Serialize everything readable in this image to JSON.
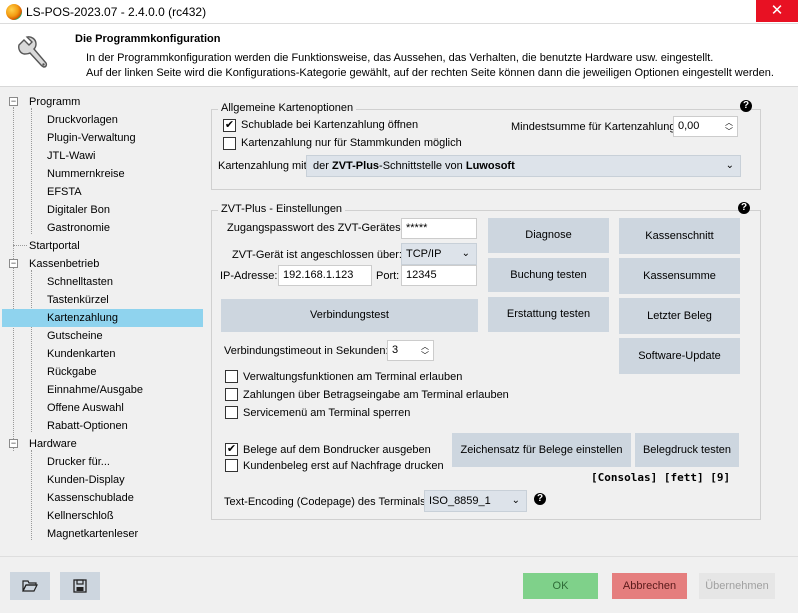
{
  "window": {
    "title": "LS-POS-2023.07 - 2.4.0.0 (rc432)",
    "close_symbol": "✕"
  },
  "header": {
    "title": "Die Programmkonfiguration",
    "desc_line1": "In der Programmkonfiguration werden die Funktionsweise, das Aussehen, das Verhalten, die benutzte Hardware usw. eingestellt.",
    "desc_line2": "Auf der linken Seite wird die Konfigurations-Kategorie gewählt, auf der rechten Seite können dann die jeweiligen Optionen eingestellt werden."
  },
  "tree": {
    "programm": "Programm",
    "programm_items": [
      "Druckvorlagen",
      "Plugin-Verwaltung",
      "JTL-Wawi",
      "Nummernkreise",
      "EFSTA",
      "Digitaler Bon",
      "Gastronomie"
    ],
    "startportal": "Startportal",
    "kassenbetrieb": "Kassenbetrieb",
    "kassenbetrieb_items": [
      "Schnelltasten",
      "Tastenkürzel",
      "Kartenzahlung",
      "Gutscheine",
      "Kundenkarten",
      "Rückgabe",
      "Einnahme/Ausgabe",
      "Offene Auswahl",
      "Rabatt-Optionen"
    ],
    "hardware": "Hardware",
    "hardware_items": [
      "Drucker für...",
      "Kunden-Display",
      "Kassenschublade",
      "Kellnerschloß",
      "Magnetkartenleser"
    ],
    "selected": "Kartenzahlung",
    "expander_symbol": "−"
  },
  "general": {
    "title": "Allgemeine Kartenoptionen",
    "help_symbol": "?",
    "check_symbol": "✔",
    "opt_drawer": "Schublade bei Kartenzahlung öffnen",
    "opt_drawer_checked": true,
    "opt_regulars": "Kartenzahlung nur für Stammkunden möglich",
    "opt_regulars_checked": false,
    "min_sum_label": "Mindestsumme für Kartenzahlung:",
    "min_sum_value": "0,00",
    "payment_label": "Kartenzahlung mit",
    "payment_prefix": "der ",
    "payment_bold1": "ZVT-Plus",
    "payment_middle": "-Schnittstelle von ",
    "payment_bold2": "Luwosoft"
  },
  "zvt": {
    "title": "ZVT-Plus  -  Einstellungen",
    "password_label": "Zugangspasswort des ZVT-Gerätes:",
    "password_value": "*****",
    "connection_label": "ZVT-Gerät ist angeschlossen über:",
    "connection_value": "TCP/IP",
    "ip_label": "IP-Adresse:",
    "ip_value": "192.168.1.123",
    "port_label": "Port:",
    "port_value": "12345",
    "btn_connection_test": "Verbindungstest",
    "btn_diagnose": "Diagnose",
    "btn_booking_test": "Buchung testen",
    "btn_refund_test": "Erstattung testen",
    "btn_cash_cut": "Kassenschnitt",
    "btn_cash_sum": "Kassensumme",
    "btn_last_receipt": "Letzter Beleg",
    "btn_software_update": "Software-Update",
    "timeout_label": "Verbindungstimeout in Sekunden:",
    "timeout_value": "3",
    "opt_admin": "Verwaltungsfunktionen am Terminal erlauben",
    "opt_amount": "Zahlungen über Betragseingabe am Terminal erlauben",
    "opt_service": "Servicemenü am Terminal sperren",
    "opt_print": "Belege auf dem Bondrucker ausgeben",
    "opt_print_checked": true,
    "opt_customer": "Kundenbeleg erst auf Nachfrage drucken",
    "btn_charset": "Zeichensatz für Belege einstellen",
    "btn_print_test": "Belegdruck testen",
    "font_info": "[Consolas] [fett] [9]",
    "encoding_label": "Text-Encoding (Codepage) des Terminals",
    "encoding_value": "ISO_8859_1"
  },
  "footer": {
    "ok": "OK",
    "cancel": "Abbrechen",
    "apply": "Übernehmen"
  },
  "colors": {
    "ok_bg": "#7fd18a",
    "cancel_bg": "#e57e7e",
    "selection": "#8fd3ee",
    "button": "#cdd6df"
  }
}
